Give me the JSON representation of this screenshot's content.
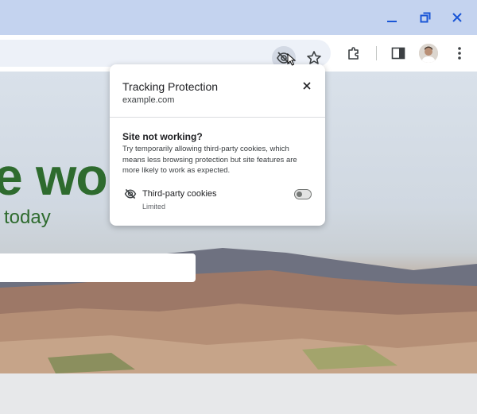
{
  "window": {
    "minimize_icon": "minimize-icon",
    "maximize_icon": "restore-icon",
    "close_icon": "close-icon"
  },
  "toolbar": {
    "icons": [
      "eye-off-icon",
      "star-icon",
      "puzzle-icon",
      "side-panel-icon",
      "avatar",
      "more-vert-icon"
    ]
  },
  "page": {
    "hero_text": "e wor",
    "hero_subtext": "today"
  },
  "popup": {
    "title": "Tracking Protection",
    "domain": "example.com",
    "section_title": "Site not working?",
    "section_description": "Try temporarily allowing third-party cookies, which means less browsing protection but site features are more likely to work as expected.",
    "cookie_label": "Third-party cookies",
    "cookie_status": "Limited",
    "toggle_on": false
  },
  "colors": {
    "titlebar": "#c4d3ef",
    "accent": "#1a56d6",
    "hero_green": "#2e6b2e"
  }
}
